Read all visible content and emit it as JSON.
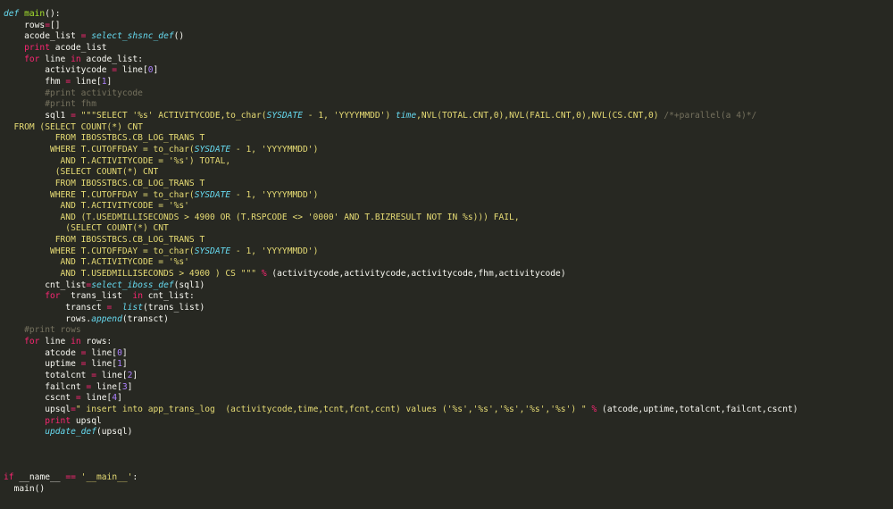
{
  "colors": {
    "background": "#272822",
    "default": "#F8F8F2",
    "keyword": "#F92672",
    "function": "#A6E22E",
    "builtin": "#66D9EF",
    "string": "#E6DB74",
    "number": "#AE81FF",
    "comment": "#75715E"
  },
  "editor": {
    "lines": [
      [
        {
          "t": "def",
          "c": "def"
        },
        {
          "t": " "
        },
        {
          "t": "main",
          "c": "fn"
        },
        {
          "t": "():"
        }
      ],
      [
        {
          "t": "    rows"
        },
        {
          "t": "=",
          "c": "kw"
        },
        {
          "t": "[]"
        }
      ],
      [
        {
          "t": "    acode_list "
        },
        {
          "t": "=",
          "c": "kw"
        },
        {
          "t": " "
        },
        {
          "t": "select_shsnc_def",
          "c": "bi"
        },
        {
          "t": "()"
        }
      ],
      [
        {
          "t": "    "
        },
        {
          "t": "print",
          "c": "kw"
        },
        {
          "t": " acode_list"
        }
      ],
      [
        {
          "t": "    "
        },
        {
          "t": "for",
          "c": "kw"
        },
        {
          "t": " line "
        },
        {
          "t": "in",
          "c": "kw"
        },
        {
          "t": " acode_list:"
        }
      ],
      [
        {
          "t": "        activitycode "
        },
        {
          "t": "=",
          "c": "kw"
        },
        {
          "t": " line["
        },
        {
          "t": "0",
          "c": "num"
        },
        {
          "t": "]"
        }
      ],
      [
        {
          "t": "        fhm "
        },
        {
          "t": "=",
          "c": "kw"
        },
        {
          "t": " line["
        },
        {
          "t": "1",
          "c": "num"
        },
        {
          "t": "]"
        }
      ],
      [
        {
          "t": "        #print activitycode",
          "c": "cm"
        }
      ],
      [
        {
          "t": "        #print fhm",
          "c": "cm"
        }
      ],
      [
        {
          "t": "        sql1 "
        },
        {
          "t": "=",
          "c": "kw"
        },
        {
          "t": " \"\"\"SELECT '%s' ACTIVITYCODE,to_char(",
          "c": "str"
        },
        {
          "t": "SYSDATE",
          "c": "ital"
        },
        {
          "t": " - 1, 'YYYYMMDD') ",
          "c": "str"
        },
        {
          "t": "time",
          "c": "ital"
        },
        {
          "t": ",NVL(TOTAL.CNT,0),NVL(FAIL.CNT,0),NVL(CS.CNT,0) ",
          "c": "str"
        },
        {
          "t": "/*+parallel(a 4)*/",
          "c": "cm"
        }
      ],
      [
        {
          "t": "  FROM (SELECT COUNT(*) CNT",
          "c": "str"
        }
      ],
      [
        {
          "t": "          FROM IBOSSTBCS.CB_LOG_TRANS T",
          "c": "str"
        }
      ],
      [
        {
          "t": "         WHERE T.CUTOFFDAY = to_char(",
          "c": "str"
        },
        {
          "t": "SYSDATE",
          "c": "ital"
        },
        {
          "t": " - 1, 'YYYYMMDD')",
          "c": "str"
        }
      ],
      [
        {
          "t": "           AND T.ACTIVITYCODE = '%s') TOTAL,",
          "c": "str"
        }
      ],
      [
        {
          "t": "          (SELECT COUNT(*) CNT",
          "c": "str"
        }
      ],
      [
        {
          "t": "          FROM IBOSSTBCS.CB_LOG_TRANS T",
          "c": "str"
        }
      ],
      [
        {
          "t": "         WHERE T.CUTOFFDAY = to_char(",
          "c": "str"
        },
        {
          "t": "SYSDATE",
          "c": "ital"
        },
        {
          "t": " - 1, 'YYYYMMDD')",
          "c": "str"
        }
      ],
      [
        {
          "t": "           AND T.ACTIVITYCODE = '%s'",
          "c": "str"
        }
      ],
      [
        {
          "t": "           AND (T.USEDMILLISECONDS > 4900 OR (T.RSPCODE <> '0000' AND T.BIZRESULT NOT IN %s))) FAIL,",
          "c": "str"
        }
      ],
      [
        {
          "t": "            (SELECT COUNT(*) CNT",
          "c": "str"
        }
      ],
      [
        {
          "t": "          FROM IBOSSTBCS.CB_LOG_TRANS T",
          "c": "str"
        }
      ],
      [
        {
          "t": "         WHERE T.CUTOFFDAY = to_char(",
          "c": "str"
        },
        {
          "t": "SYSDATE",
          "c": "ital"
        },
        {
          "t": " - 1, 'YYYYMMDD')",
          "c": "str"
        }
      ],
      [
        {
          "t": "           AND T.ACTIVITYCODE = '%s'",
          "c": "str"
        }
      ],
      [
        {
          "t": "           AND T.USEDMILLISECONDS > 4900 ) CS \"\"\"",
          "c": "str"
        },
        {
          "t": " "
        },
        {
          "t": "%",
          "c": "kw"
        },
        {
          "t": " (activitycode,activitycode,activitycode,fhm,activitycode)"
        }
      ],
      [
        {
          "t": "        cnt_list"
        },
        {
          "t": "=",
          "c": "kw"
        },
        {
          "t": "select_iboss_def",
          "c": "bi"
        },
        {
          "t": "(sql1)"
        }
      ],
      [
        {
          "t": "        "
        },
        {
          "t": "for",
          "c": "kw"
        },
        {
          "t": "  trans_list  "
        },
        {
          "t": "in",
          "c": "kw"
        },
        {
          "t": " cnt_list:"
        }
      ],
      [
        {
          "t": "            transct "
        },
        {
          "t": "=",
          "c": "kw"
        },
        {
          "t": "  "
        },
        {
          "t": "list",
          "c": "ital"
        },
        {
          "t": "(trans_list)"
        }
      ],
      [
        {
          "t": "            rows."
        },
        {
          "t": "append",
          "c": "bi"
        },
        {
          "t": "(transct)"
        }
      ],
      [
        {
          "t": "    #print rows",
          "c": "cm"
        }
      ],
      [
        {
          "t": "    "
        },
        {
          "t": "for",
          "c": "kw"
        },
        {
          "t": " line "
        },
        {
          "t": "in",
          "c": "kw"
        },
        {
          "t": " rows:"
        }
      ],
      [
        {
          "t": "        atcode "
        },
        {
          "t": "=",
          "c": "kw"
        },
        {
          "t": " line["
        },
        {
          "t": "0",
          "c": "num"
        },
        {
          "t": "]"
        }
      ],
      [
        {
          "t": "        uptime "
        },
        {
          "t": "=",
          "c": "kw"
        },
        {
          "t": " line["
        },
        {
          "t": "1",
          "c": "num"
        },
        {
          "t": "]"
        }
      ],
      [
        {
          "t": "        totalcnt "
        },
        {
          "t": "=",
          "c": "kw"
        },
        {
          "t": " line["
        },
        {
          "t": "2",
          "c": "num"
        },
        {
          "t": "]"
        }
      ],
      [
        {
          "t": "        failcnt "
        },
        {
          "t": "=",
          "c": "kw"
        },
        {
          "t": " line["
        },
        {
          "t": "3",
          "c": "num"
        },
        {
          "t": "]"
        }
      ],
      [
        {
          "t": "        cscnt "
        },
        {
          "t": "=",
          "c": "kw"
        },
        {
          "t": " line["
        },
        {
          "t": "4",
          "c": "num"
        },
        {
          "t": "]"
        }
      ],
      [
        {
          "t": "        upsql"
        },
        {
          "t": "=",
          "c": "kw"
        },
        {
          "t": "\" insert into app_trans_log  (activitycode,time,tcnt,fcnt,ccnt) values ('%s','%s','%s','%s','%s') \"",
          "c": "str"
        },
        {
          "t": " "
        },
        {
          "t": "%",
          "c": "kw"
        },
        {
          "t": " (atcode,uptime,totalcnt,failcnt,cscnt)"
        }
      ],
      [
        {
          "t": "        "
        },
        {
          "t": "print",
          "c": "kw"
        },
        {
          "t": " upsql"
        }
      ],
      [
        {
          "t": "        "
        },
        {
          "t": "update_def",
          "c": "bi"
        },
        {
          "t": "(upsql)"
        }
      ],
      [],
      [],
      [],
      [
        {
          "t": "if",
          "c": "kw"
        },
        {
          "t": " __name__ "
        },
        {
          "t": "==",
          "c": "kw"
        },
        {
          "t": " "
        },
        {
          "t": "'__main__'",
          "c": "str"
        },
        {
          "t": ":"
        }
      ],
      [
        {
          "t": "  main()"
        }
      ]
    ]
  }
}
